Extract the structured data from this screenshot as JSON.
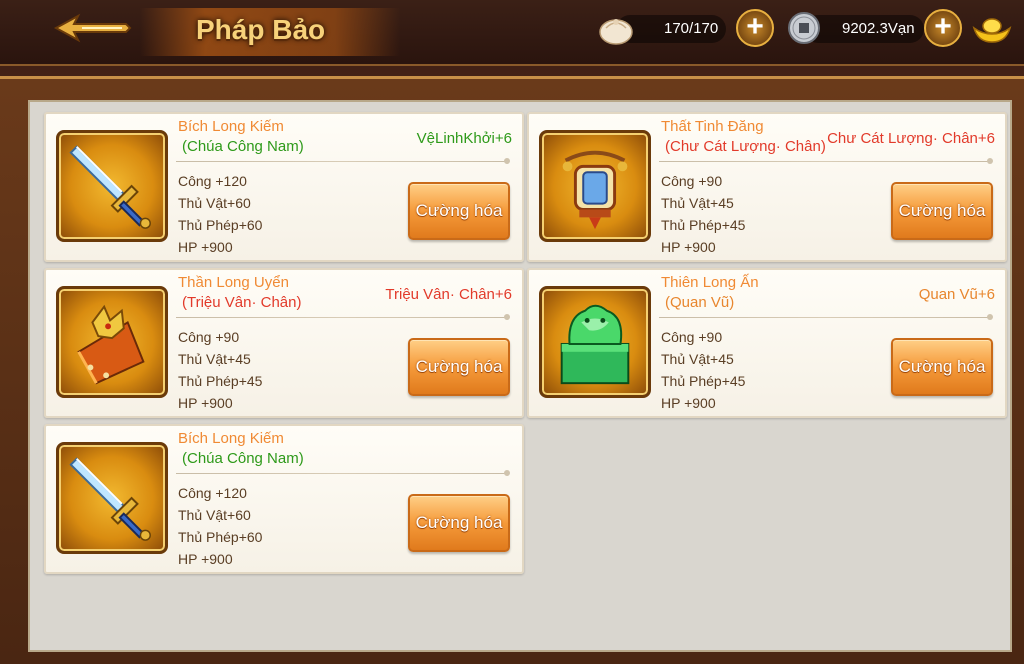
{
  "header": {
    "title": "Pháp Bảo",
    "stamina": "170/170",
    "silver": "9202.3Vạn",
    "plus_label": "+"
  },
  "icons": {
    "back": "back-arrow-icon",
    "stamina": "bun-icon",
    "silver": "silver-coin-icon",
    "gold": "gold-ingot-icon"
  },
  "colors": {
    "title": "#f7d27a",
    "item_name": "#f08a34",
    "owner_green": "#2e9a1a",
    "owner_red": "#e23a2a",
    "button": "#f59a3a"
  },
  "cards": [
    {
      "name": "Bích Long Kiếm",
      "owner": "(Chúa Công Nam)",
      "owner_color": "green",
      "bonus": "VệLinhKhởi+6",
      "bonus_color": "green",
      "stats": [
        "Công +120",
        "Thủ Vật+60",
        "Thủ Phép+60",
        "HP +900"
      ],
      "button": "Cường hóa",
      "icon": "sword-icon"
    },
    {
      "name": "Thất Tinh Đăng",
      "owner": "(Chư Cát Lượng· Chân)",
      "owner_color": "red",
      "bonus": "Chư Cát Lượng· Chân+6",
      "bonus_color": "red",
      "stats": [
        "Công +90",
        "Thủ Vật+45",
        "Thủ Phép+45",
        "HP +900"
      ],
      "button": "Cường hóa",
      "icon": "lantern-icon"
    },
    {
      "name": "Thần Long Uyển",
      "owner": "(Triệu Vân· Chân)",
      "owner_color": "red",
      "bonus": "Triệu Vân· Chân+6",
      "bonus_color": "red",
      "stats": [
        "Công +90",
        "Thủ Vật+45",
        "Thủ Phép+45",
        "HP +900"
      ],
      "button": "Cường hóa",
      "icon": "dragon-bracer-icon"
    },
    {
      "name": "Thiên Long Ấn",
      "owner": "(Quan Vũ)",
      "owner_color": "orange",
      "bonus": "Quan Vũ+6",
      "bonus_color": "orange",
      "stats": [
        "Công +90",
        "Thủ Vật+45",
        "Thủ Phép+45",
        "HP +900"
      ],
      "button": "Cường hóa",
      "icon": "jade-seal-icon"
    },
    {
      "name": "Bích Long Kiếm",
      "owner": "(Chúa Công Nam)",
      "owner_color": "green",
      "bonus": "",
      "bonus_color": "green",
      "stats": [
        "Công +120",
        "Thủ Vật+60",
        "Thủ Phép+60",
        "HP +900"
      ],
      "button": "Cường hóa",
      "icon": "sword-icon"
    }
  ]
}
